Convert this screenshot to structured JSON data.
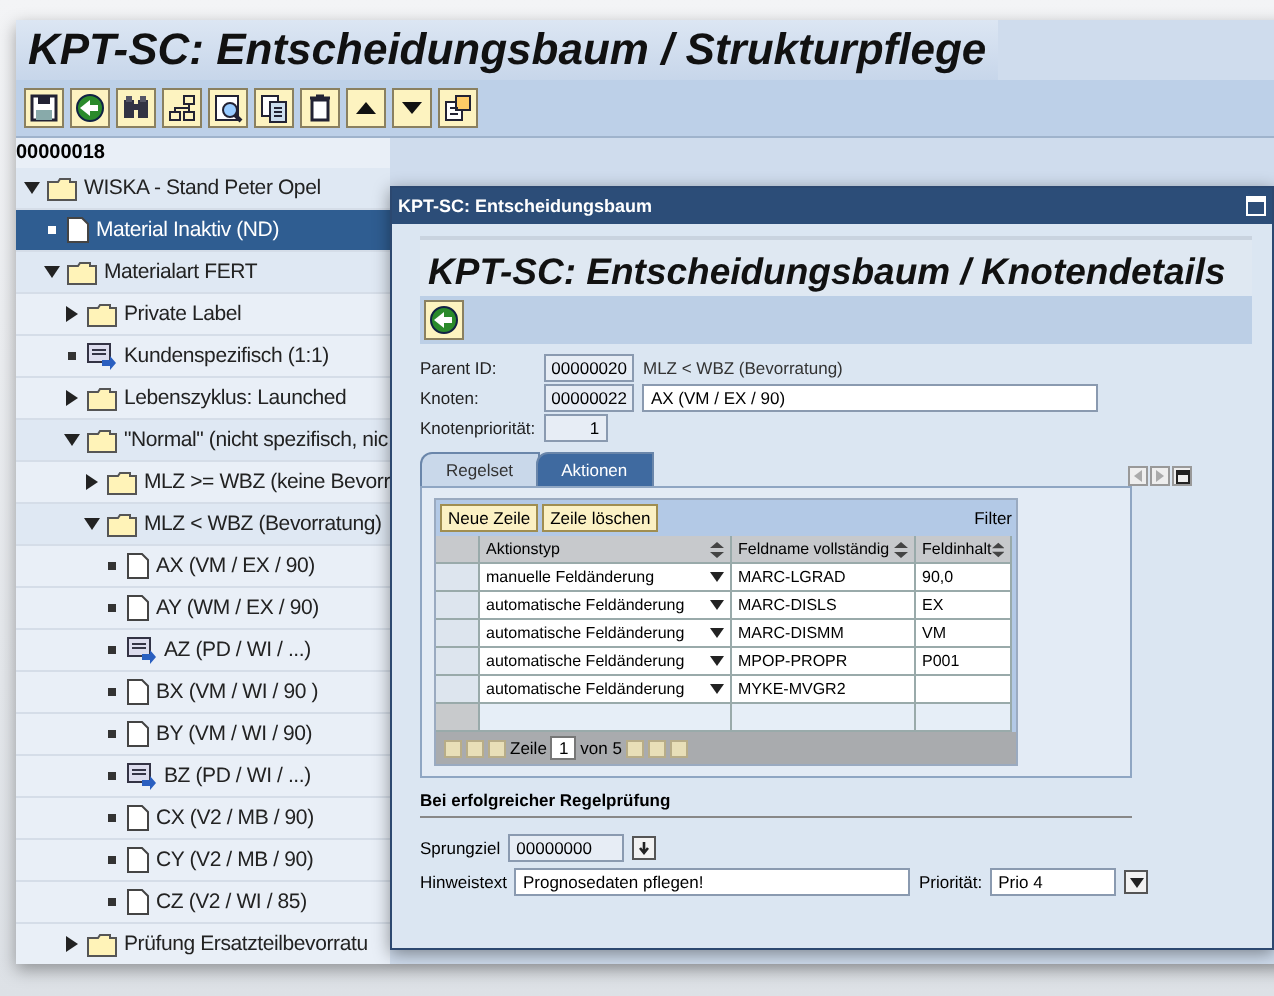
{
  "window": {
    "title": "KPT-SC: Entscheidungsbaum / Strukturpflege"
  },
  "toolbar": [
    {
      "kind": "save"
    },
    {
      "kind": "back"
    },
    {
      "kind": "find"
    },
    {
      "kind": "hierarchy"
    },
    {
      "kind": "find-next"
    },
    {
      "kind": "copy"
    },
    {
      "kind": "delete"
    },
    {
      "kind": "up"
    },
    {
      "kind": "down"
    },
    {
      "kind": "expand"
    }
  ],
  "tree": {
    "root_id": "00000018",
    "nodes": [
      {
        "label": "WISKA - Stand Peter Opel",
        "kind": "folder",
        "expanded": true,
        "selected": false,
        "children": [
          {
            "label": "Material Inaktiv (ND)",
            "kind": "doc",
            "selected": true
          },
          {
            "label": "Materialart FERT",
            "kind": "folder",
            "expanded": true,
            "selected": false,
            "children": [
              {
                "label": "Private Label",
                "kind": "folder",
                "expanded": false,
                "selected": false
              },
              {
                "label": "Kundenspezifisch (1:1)",
                "kind": "special",
                "selected": false
              },
              {
                "label": "Lebenszyklus: Launched",
                "kind": "folder",
                "expanded": false,
                "selected": false
              },
              {
                "label": "\"Normal\" (nicht spezifisch, nic",
                "kind": "folder",
                "expanded": true,
                "selected": false,
                "children": [
                  {
                    "label": "MLZ >= WBZ (keine Bevorr",
                    "kind": "folder",
                    "expanded": false,
                    "selected": false
                  },
                  {
                    "label": "MLZ < WBZ (Bevorratung)",
                    "kind": "folder",
                    "expanded": true,
                    "selected": false,
                    "children": [
                      {
                        "label": "AX (VM / EX / 90)",
                        "kind": "doc",
                        "selected": false
                      },
                      {
                        "label": "AY (WM / EX / 90)",
                        "kind": "doc",
                        "selected": false
                      },
                      {
                        "label": "AZ (PD / WI / ...)",
                        "kind": "special",
                        "selected": false
                      },
                      {
                        "label": "BX (VM / WI / 90 )",
                        "kind": "doc",
                        "selected": false
                      },
                      {
                        "label": "BY (VM / WI / 90)",
                        "kind": "doc",
                        "selected": false
                      },
                      {
                        "label": "BZ (PD / WI / ...)",
                        "kind": "special",
                        "selected": false
                      },
                      {
                        "label": "CX (V2 / MB / 90)",
                        "kind": "doc",
                        "selected": false
                      },
                      {
                        "label": "CY (V2 / MB / 90)",
                        "kind": "doc",
                        "selected": false
                      },
                      {
                        "label": "CZ (V2 / WI / 85)",
                        "kind": "doc",
                        "selected": false
                      }
                    ]
                  }
                ]
              },
              {
                "label": "Prüfung Ersatzteilbevorratu",
                "kind": "folder",
                "expanded": false,
                "selected": false
              }
            ]
          }
        ]
      }
    ]
  },
  "dialog": {
    "title": "KPT-SC: Entscheidungsbaum",
    "heading": "KPT-SC: Entscheidungsbaum / Knotendetails",
    "toolbar": [
      {
        "kind": "back"
      }
    ],
    "parent_id": {
      "label": "Parent ID:",
      "value": "00000020",
      "text": "MLZ < WBZ (Bevorratung)"
    },
    "knoten": {
      "label": "Knoten:",
      "value": "00000022",
      "text": "AX (VM / EX / 90)"
    },
    "priority": {
      "label": "Knotenpriorität:",
      "value": "1"
    },
    "tabs": [
      {
        "label": "Regelset",
        "selected": false
      },
      {
        "label": "Aktionen",
        "selected": true
      }
    ],
    "table": {
      "buttons": [
        "Neue Zeile",
        "Zeile löschen"
      ],
      "filter": "Filter",
      "columns": [
        "Aktionstyp",
        "Feldname vollständig",
        "Feldinhalt"
      ],
      "rows": [
        {
          "type": "manuelle Feldänderung",
          "field": "MARC-LGRAD",
          "value": "90,0"
        },
        {
          "type": "automatische Feldänderung",
          "field": "MARC-DISLS",
          "value": "EX"
        },
        {
          "type": "automatische Feldänderung",
          "field": "MARC-DISMM",
          "value": "VM"
        },
        {
          "type": "automatische Feldänderung",
          "field": "MPOP-PROPR",
          "value": "P001"
        },
        {
          "type": "automatische Feldänderung",
          "field": "MYKE-MVGR2"
        }
      ],
      "pager": {
        "label": "Zeile",
        "value": "1",
        "total": "von 5"
      }
    },
    "section": {
      "title": "Bei erfolgreicher Regelprüfung",
      "sprungziel": {
        "label": "Sprungziel",
        "value": "00000000"
      },
      "hinweistext": {
        "label": "Hinweistext",
        "value": "Prognosedaten pflegen!"
      },
      "priority": {
        "label": "Priorität:",
        "value": "Prio 4"
      }
    }
  }
}
